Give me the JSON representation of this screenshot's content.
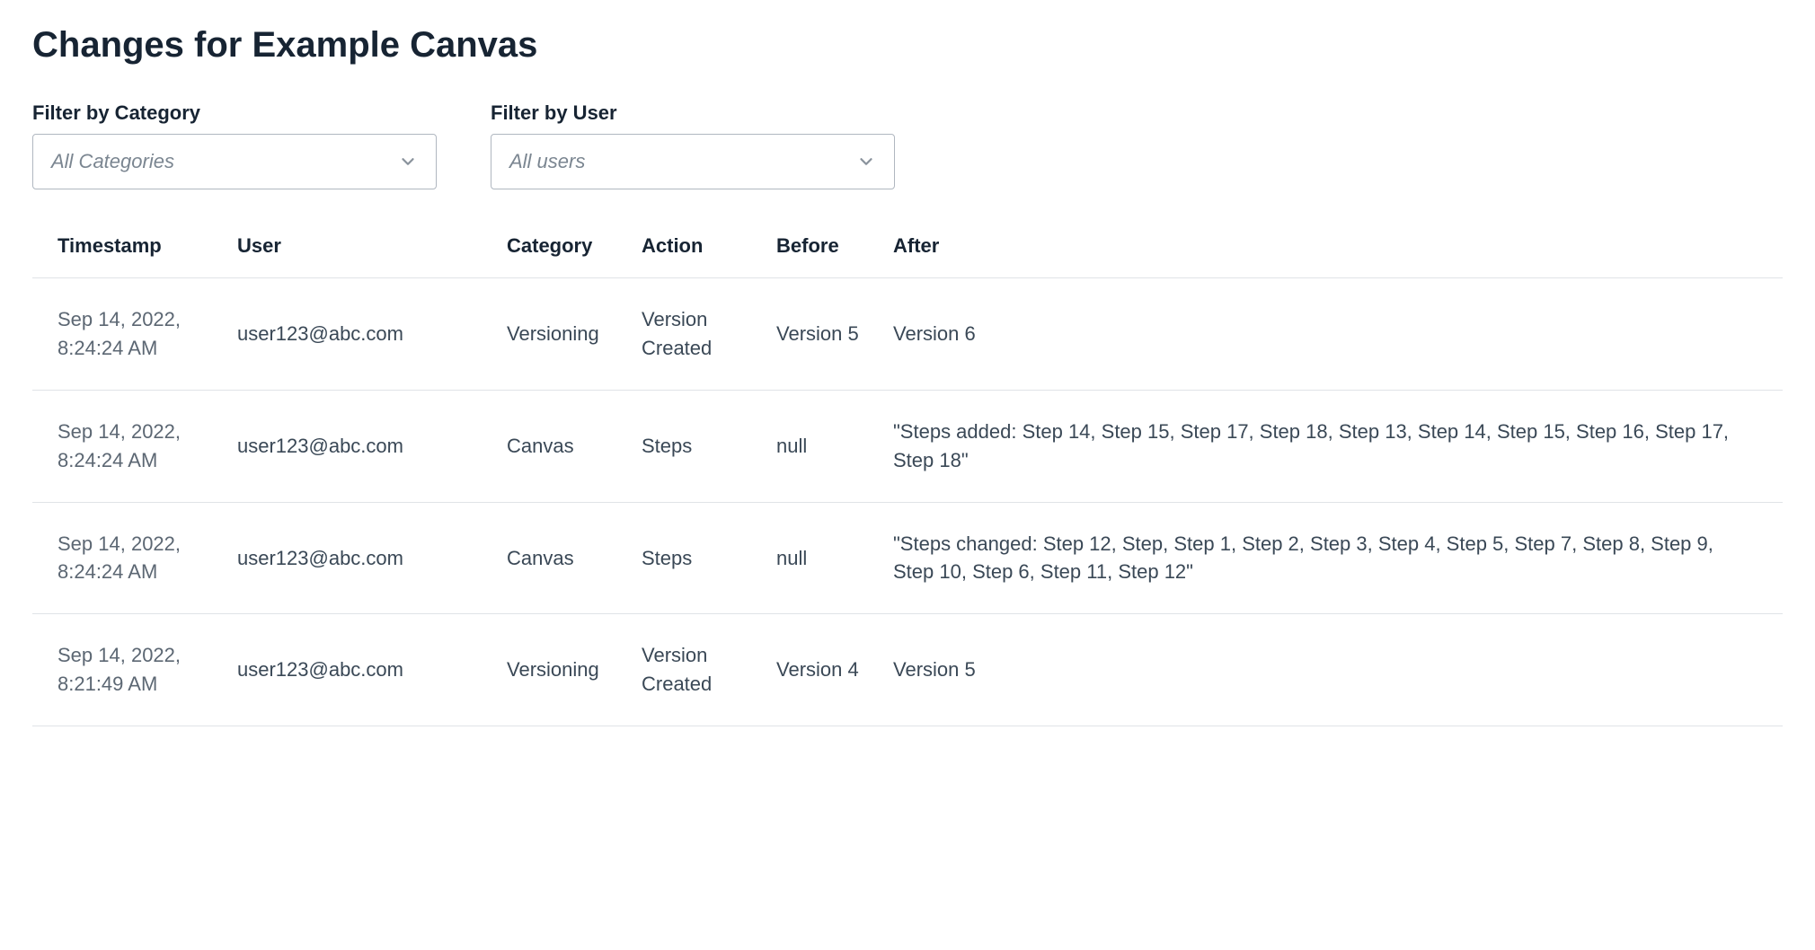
{
  "title": "Changes for Example Canvas",
  "filters": {
    "category": {
      "label": "Filter by Category",
      "value": "All Categories"
    },
    "user": {
      "label": "Filter by User",
      "value": "All users"
    }
  },
  "columns": [
    "Timestamp",
    "User",
    "Category",
    "Action",
    "Before",
    "After"
  ],
  "rows": [
    {
      "timestamp": "Sep 14, 2022, 8:24:24 AM",
      "user": "user123@abc.com",
      "category": "Versioning",
      "action": "Version Created",
      "before": "Version 5",
      "after": "Version 6"
    },
    {
      "timestamp": "Sep 14, 2022, 8:24:24 AM",
      "user": "user123@abc.com",
      "category": "Canvas",
      "action": "Steps",
      "before": "null",
      "after": "\"Steps added: Step 14, Step 15, Step 17, Step 18, Step 13, Step 14, Step 15, Step 16, Step 17, Step 18\""
    },
    {
      "timestamp": "Sep 14, 2022, 8:24:24 AM",
      "user": "user123@abc.com",
      "category": "Canvas",
      "action": "Steps",
      "before": "null",
      "after": "\"Steps changed: Step 12, Step, Step 1, Step 2, Step 3, Step 4, Step 5, Step 7, Step 8, Step 9, Step 10, Step 6, Step 11, Step 12\""
    },
    {
      "timestamp": "Sep 14, 2022, 8:21:49 AM",
      "user": "user123@abc.com",
      "category": "Versioning",
      "action": "Version Created",
      "before": "Version 4",
      "after": "Version 5"
    }
  ]
}
